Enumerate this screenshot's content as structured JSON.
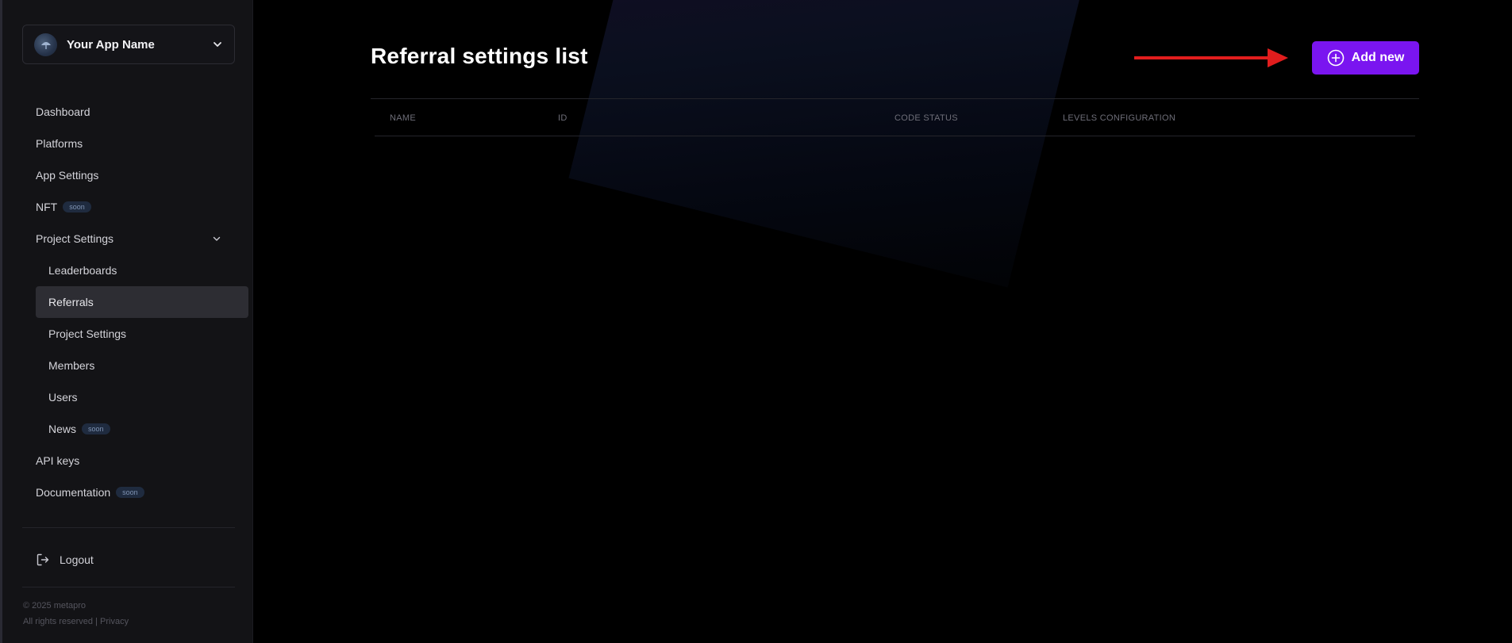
{
  "sidebar": {
    "app_name": "Your App Name",
    "nav": [
      {
        "label": "Dashboard"
      },
      {
        "label": "Platforms"
      },
      {
        "label": "App Settings"
      },
      {
        "label": "NFT",
        "badge": "soon"
      },
      {
        "label": "Project Settings"
      },
      {
        "label": "Leaderboards"
      },
      {
        "label": "Referrals",
        "active": true
      },
      {
        "label": "Project Settings"
      },
      {
        "label": "Members"
      },
      {
        "label": "Users"
      },
      {
        "label": "News",
        "badge": "soon"
      },
      {
        "label": "API keys"
      },
      {
        "label": "Documentation",
        "badge": "soon"
      }
    ],
    "logout_label": "Logout",
    "footer": {
      "copyright": "© 2025 metapro",
      "rights": "All rights reserved | ",
      "privacy": "Privacy"
    }
  },
  "main": {
    "title": "Referral settings list",
    "add_button_label": "Add new",
    "columns": [
      "NAME",
      "ID",
      "CODE STATUS",
      "LEVELS CONFIGURATION"
    ]
  },
  "colors": {
    "accent": "#7a15f0",
    "arrow": "#e11d1d",
    "sidebar_bg": "#131316",
    "active_item_bg": "#2d2d33"
  }
}
